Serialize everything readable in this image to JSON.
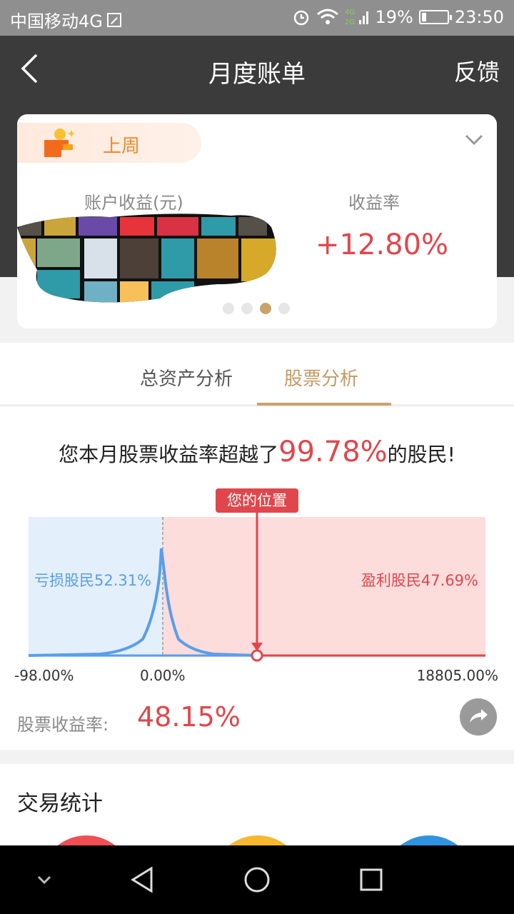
{
  "status": {
    "carrier": "中国移动4G",
    "battery": "19%",
    "battery_fraction": 0.19,
    "network": "4G 2G",
    "time": "23:50"
  },
  "header": {
    "title": "月度账单",
    "feedback": "反馈"
  },
  "summary": {
    "period": "上周",
    "income_label": "账户收益(元)",
    "rate_label": "收益率",
    "rate_value": "+12.80%",
    "page_dots": 4,
    "active_dot": 3
  },
  "tabs": [
    {
      "label": "总资产分析",
      "active": false
    },
    {
      "label": "股票分析",
      "active": true
    }
  ],
  "analysis": {
    "headline_prefix": "您本月股票收益率超越了",
    "headline_pct": "99.78%",
    "headline_suffix": "的股民!",
    "marker_label": "您的位置",
    "loss_label": "亏损股民52.31%",
    "profit_label": "盈利股民47.69%",
    "x_ticks": [
      "-98.00%",
      "0.00%",
      "18805.00%"
    ],
    "stock_rate_label": "股票收益率:",
    "stock_rate_value": "48.15%"
  },
  "chart_data": {
    "type": "area",
    "x_range": [
      -98.0,
      18805.0
    ],
    "loss_share_pct": 52.31,
    "profit_share_pct": 47.69,
    "user_position_pct": 48.15,
    "colors": {
      "loss": "#4a90e2",
      "profit": "#e0474c",
      "loss_bg": "#e3effb",
      "profit_bg": "#fddcdc",
      "curve": "#5a9ee8"
    }
  },
  "trade": {
    "title": "交易统计"
  },
  "colors": {
    "accent": "#c9a36a",
    "positive": "#e0474c",
    "header_bg": "#3b3b3b"
  }
}
